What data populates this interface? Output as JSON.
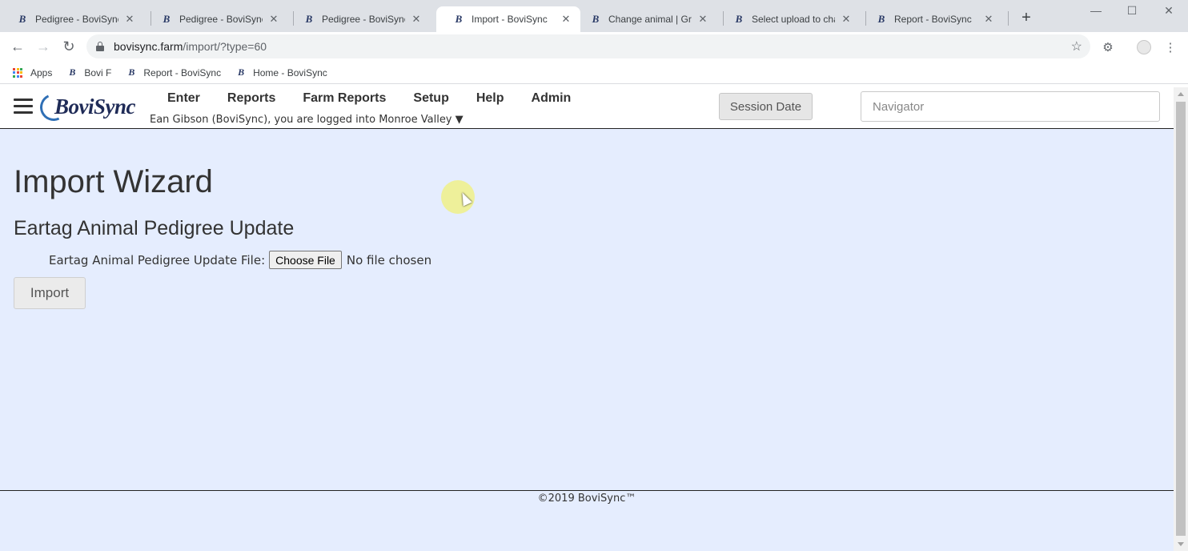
{
  "browser": {
    "tabs": [
      {
        "title": "Pedigree - BoviSync",
        "active": false
      },
      {
        "title": "Pedigree - BoviSync",
        "active": false
      },
      {
        "title": "Pedigree - BoviSync",
        "active": false
      },
      {
        "title": "Import - BoviSync",
        "active": true
      },
      {
        "title": "Change animal | Grap",
        "active": false
      },
      {
        "title": "Select upload to char",
        "active": false
      },
      {
        "title": "Report - BoviSync",
        "active": false
      }
    ],
    "new_tab_label": "+",
    "url_host": "bovisync.farm",
    "url_path": "/import/?type=60",
    "bookmarks": [
      {
        "label": "Apps",
        "icon": "apps-grid-icon"
      },
      {
        "label": "Bovi F",
        "icon": "bovisync-favicon"
      },
      {
        "label": "Report - BoviSync",
        "icon": "bovisync-favicon"
      },
      {
        "label": "Home - BoviSync",
        "icon": "bovisync-favicon"
      }
    ]
  },
  "header": {
    "logo_text": "BoviSync",
    "nav": [
      "Enter",
      "Reports",
      "Farm Reports",
      "Setup",
      "Help",
      "Admin"
    ],
    "login_text": "Ean Gibson (BoviSync), you are logged into",
    "farm": "Monroe Valley",
    "farm_caret": "▼",
    "session_date_label": "Session Date",
    "navigator_placeholder": "Navigator"
  },
  "page": {
    "title": "Import Wizard",
    "subtitle": "Eartag Animal Pedigree Update",
    "file_label": "Eartag Animal Pedigree Update File:",
    "choose_file_label": "Choose File",
    "no_file_text": "No file chosen",
    "import_button_label": "Import"
  },
  "footer": {
    "copyright": "©2019 BoviSync™"
  },
  "colors": {
    "page_background": "#e5edfe",
    "logo_blue": "#1f2b57"
  }
}
